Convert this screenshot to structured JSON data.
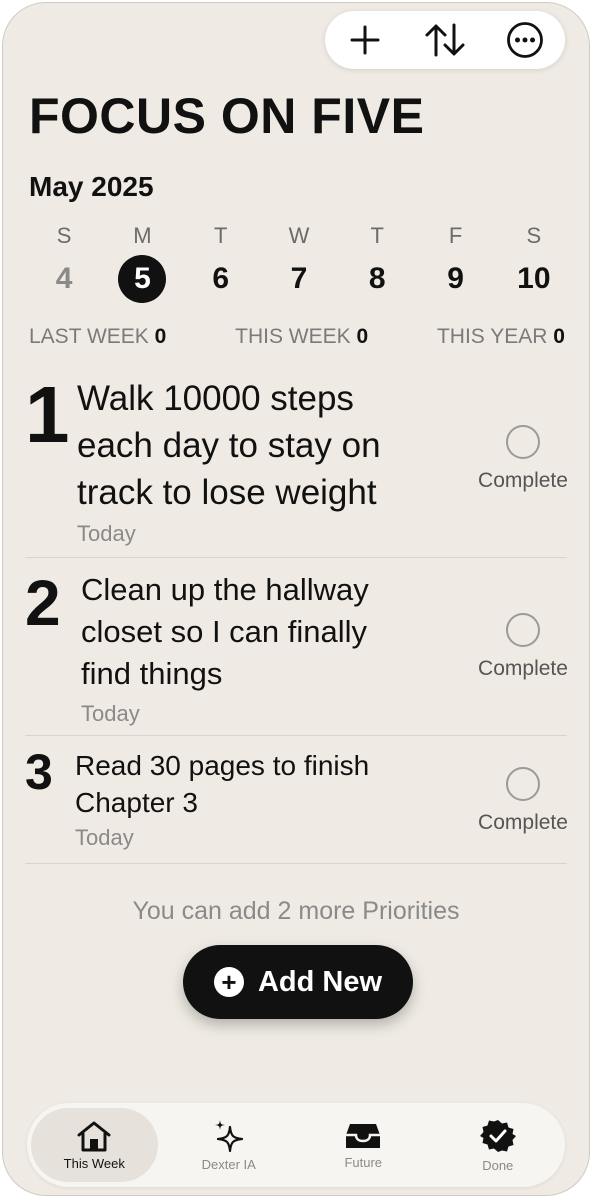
{
  "toolbar": {
    "add_icon": "plus-icon",
    "sort_icon": "sort-arrows-icon",
    "more_icon": "ellipsis-circle-icon"
  },
  "title": "FOCUS ON FIVE",
  "month": "May 2025",
  "week": {
    "days": [
      {
        "dow": "S",
        "num": "4"
      },
      {
        "dow": "M",
        "num": "5"
      },
      {
        "dow": "T",
        "num": "6"
      },
      {
        "dow": "W",
        "num": "7"
      },
      {
        "dow": "T",
        "num": "8"
      },
      {
        "dow": "F",
        "num": "9"
      },
      {
        "dow": "S",
        "num": "10"
      }
    ],
    "selected_index": 1
  },
  "stats": {
    "last_week_label": "LAST WEEK",
    "last_week_value": "0",
    "this_week_label": "THIS WEEK",
    "this_week_value": "0",
    "this_year_label": "THIS YEAR",
    "this_year_value": "0"
  },
  "tasks": [
    {
      "num": "1",
      "text": "Walk 10000 steps each day to stay on track to lose weight",
      "date": "Today",
      "complete_label": "Complete"
    },
    {
      "num": "2",
      "text": "Clean up the hallway closet so I can finally find things",
      "date": "Today",
      "complete_label": "Complete"
    },
    {
      "num": "3",
      "text": "Read 30 pages to finish Chapter 3",
      "date": "Today",
      "complete_label": "Complete"
    }
  ],
  "hint": "You can add 2 more Priorities",
  "add_button": {
    "label": "Add New"
  },
  "tabs": [
    {
      "label": "This Week",
      "icon": "house-icon"
    },
    {
      "label": "Dexter IA",
      "icon": "sparkles-icon"
    },
    {
      "label": "Future",
      "icon": "tray-icon"
    },
    {
      "label": "Done",
      "icon": "checkmark-seal-icon"
    }
  ]
}
